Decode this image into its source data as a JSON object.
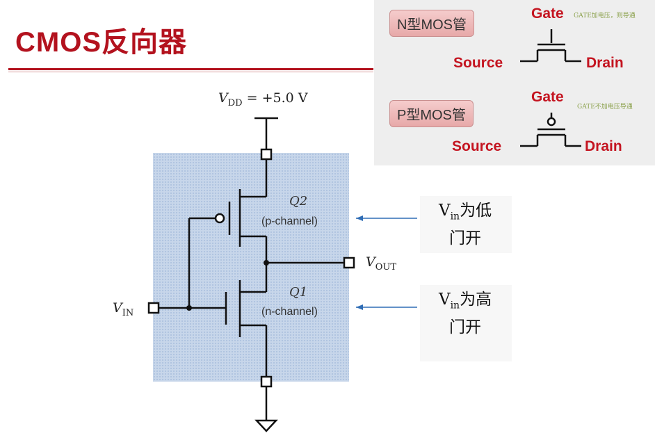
{
  "title": "CMOS反向器",
  "legend": {
    "nmos": {
      "tag": "N型MOS管",
      "gate": "Gate",
      "source": "Source",
      "drain": "Drain",
      "note": "GATE加电压，则导通"
    },
    "pmos": {
      "tag": "P型MOS管",
      "gate": "Gate",
      "source": "Source",
      "drain": "Drain",
      "note": "GATE不加电压导通"
    }
  },
  "circuit": {
    "vdd": "= +5.0 V",
    "vdd_symbol": "V",
    "vdd_sub": "DD",
    "vin_symbol": "V",
    "vin_sub": "IN",
    "vout_symbol": "V",
    "vout_sub": "OUT",
    "q2_name": "Q2",
    "q2_type": "(p-channel)",
    "q1_name": "Q1",
    "q1_type": "(n-channel)"
  },
  "annotations": {
    "low": {
      "v": "V",
      "sub": "in",
      "line1": "为低",
      "line2": "门开"
    },
    "high": {
      "v": "V",
      "sub": "in",
      "line1": "为高",
      "line2": "门开"
    }
  },
  "colors": {
    "title": "#b3121e",
    "legend_label": "#c41420",
    "arrow": "#2f6db5"
  }
}
